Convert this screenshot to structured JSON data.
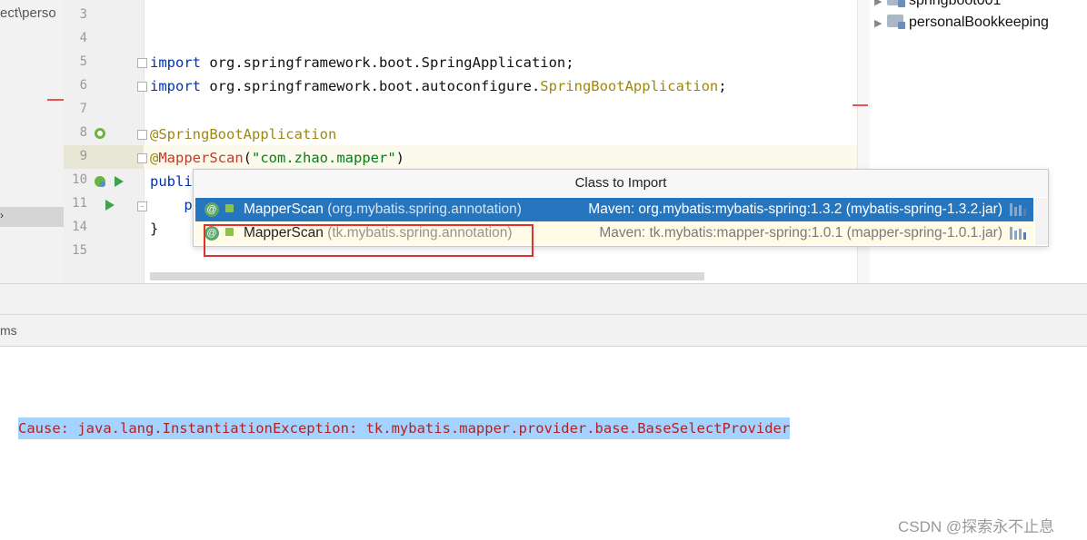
{
  "project": {
    "path_fragment": "ect\\perso"
  },
  "editor": {
    "line_numbers": [
      "3",
      "4",
      "5",
      "6",
      "7",
      "8",
      "9",
      "10",
      "11",
      "14",
      "15"
    ],
    "lines": {
      "l5_kw": "import",
      "l5_rest": " org.springframework.boot.SpringApplication;",
      "l6_kw": "import",
      "l6_rest1": " org.springframework.boot.autoconfigure.",
      "l6_ann": "SpringBootApplication",
      "l6_end": ";",
      "l8": "@SpringBootApplication",
      "l9_at": "@",
      "l9_name": "MapperScan",
      "l9_open": "(",
      "l9_str": "\"com.zhao.mapper\"",
      "l9_close": ")",
      "l10": "publi",
      "l11": "    p",
      "l14": "}"
    }
  },
  "maven_tree": {
    "items": [
      {
        "label": "springboot001"
      },
      {
        "label": "personalBookkeeping"
      }
    ]
  },
  "popup": {
    "title": "Class to Import",
    "rows": [
      {
        "badge": "@",
        "name": "MapperScan",
        "pkg": " (org.mybatis.spring.annotation)",
        "maven": "Maven: org.mybatis:mybatis-spring:1.3.2 (mybatis-spring-1.3.2.jar)"
      },
      {
        "badge": "@",
        "name": "MapperScan",
        "pkg": " (tk.mybatis.spring.annotation)",
        "maven": "Maven: tk.mybatis:mapper-spring:1.0.1 (mapper-spring-1.0.1.jar)"
      }
    ]
  },
  "bottom": {
    "tab_fragment": "ms",
    "cause": "Cause: java.lang.InstantiationException: tk.mybatis.mapper.provider.base.BaseSelectProvider"
  },
  "watermark": "CSDN @探索永不止息",
  "colors": {
    "selection": "#2675bf",
    "highlight_box": "#e03030",
    "console_selection": "#a6d2ff"
  }
}
